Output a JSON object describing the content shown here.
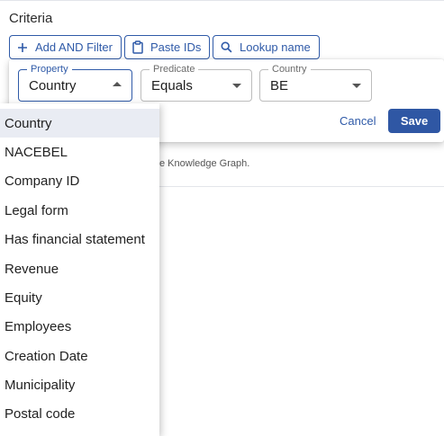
{
  "criteria": {
    "title": "Criteria",
    "buttons": {
      "add_and_filter": "Add AND Filter",
      "paste_ids": "Paste IDs",
      "lookup_name": "Lookup name"
    }
  },
  "background": {
    "hint_text": "e Knowledge Graph."
  },
  "editor": {
    "property": {
      "label": "Property",
      "value": "Country"
    },
    "predicate": {
      "label": "Predicate",
      "value": "Equals"
    },
    "country": {
      "label": "Country",
      "value": "BE"
    },
    "cancel_label": "Cancel",
    "save_label": "Save"
  },
  "menu": {
    "selected_index": 0,
    "items": [
      "Country",
      "NACEBEL",
      "Company ID",
      "Legal form",
      "Has financial statement",
      "Revenue",
      "Equity",
      "Employees",
      "Creation Date",
      "Municipality",
      "Postal code"
    ]
  },
  "colors": {
    "accent": "#2f5aa8",
    "save_button": "#2f57a4",
    "selected_item_bg": "#e9ecf3"
  }
}
